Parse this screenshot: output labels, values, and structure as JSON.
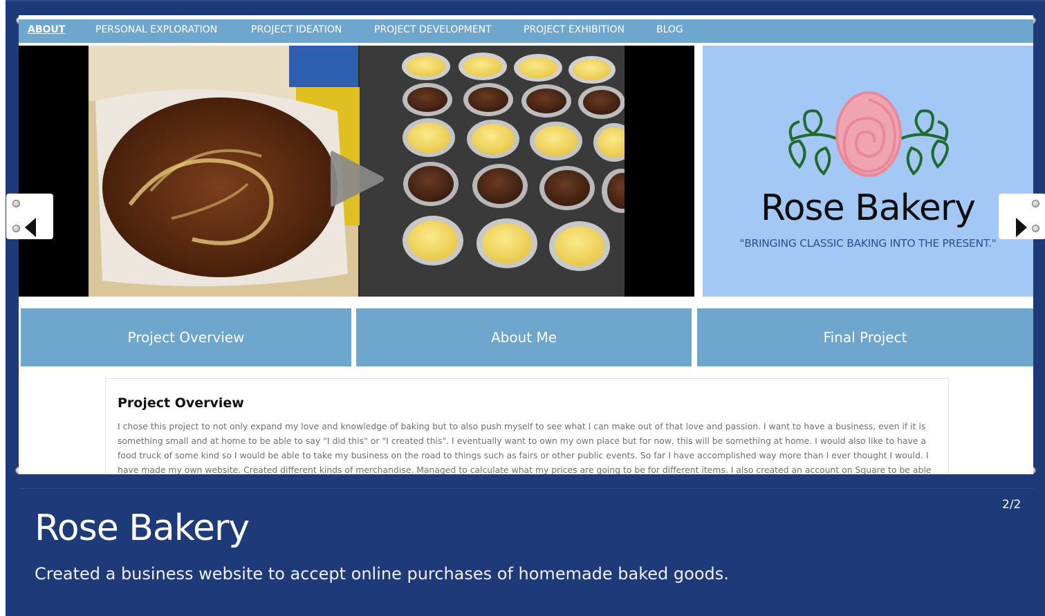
{
  "nav": {
    "items": [
      {
        "label": "ABOUT",
        "active": true
      },
      {
        "label": "PERSONAL EXPLORATION"
      },
      {
        "label": "PROJECT IDEATION"
      },
      {
        "label": "PROJECT DEVELOPMENT"
      },
      {
        "label": "PROJECT EXHIBITION"
      },
      {
        "label": "BLOG"
      }
    ]
  },
  "logo": {
    "title": "Rose Bakery",
    "tagline": "\"BRINGING CLASSIC BAKING INTO THE PRESENT.\""
  },
  "tabs": [
    "Project Overview",
    "About Me",
    "Final Project"
  ],
  "content": {
    "title": "Project Overview",
    "body": "I chose this project to not only expand my love and knowledge of baking but to also push myself to see what I can make out of that love and passion. I want to have a business, even if it is something small and at home to be able to say \"I did this\" or \"I created this\". I eventually want to own my own place but for now, this will be something at home. I would also like to have a food truck of some kind so I would be able to take my business on the road to things such as fairs or other public events. So far I have accomplished way more than I ever thought I would. I have made my own website. Created different kinds of merchandise. Managed to calculate what my prices are going to be for different items. I also created an account on Square to be able"
  },
  "caption": {
    "title": "Rose Bakery",
    "description": "Created a business website to accept online purchases of homemade baked goods.",
    "counter": "2/2"
  },
  "icons": {
    "play": "play-icon",
    "prev": "chevron-left-icon",
    "next": "chevron-right-icon"
  },
  "colors": {
    "frame": "#1e3a78",
    "nav": "#6fa6cd",
    "logo_bg": "#a4c8f5",
    "rose": "#e8889a",
    "leaf": "#1f6b2e"
  }
}
